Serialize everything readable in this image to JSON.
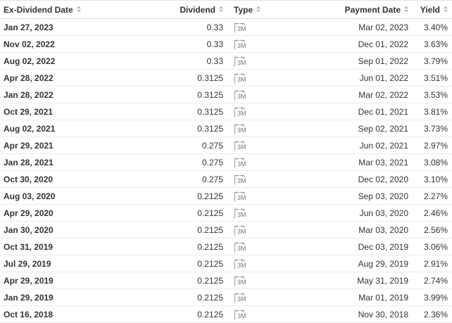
{
  "table": {
    "headers": {
      "ex_dividend_date": "Ex-Dividend Date",
      "dividend": "Dividend",
      "type": "Type",
      "payment_date": "Payment Date",
      "yield": "Yield"
    },
    "type_icon": "calendar-icon",
    "rows": [
      {
        "ex_date": "Jan 27, 2023",
        "dividend": "0.33",
        "type": "3M",
        "pay_date": "Mar 02, 2023",
        "yield": "3.40%"
      },
      {
        "ex_date": "Nov 02, 2022",
        "dividend": "0.33",
        "type": "3M",
        "pay_date": "Dec 01, 2022",
        "yield": "3.63%"
      },
      {
        "ex_date": "Aug 02, 2022",
        "dividend": "0.33",
        "type": "3M",
        "pay_date": "Sep 01, 2022",
        "yield": "3.79%"
      },
      {
        "ex_date": "Apr 28, 2022",
        "dividend": "0.3125",
        "type": "3M",
        "pay_date": "Jun 01, 2022",
        "yield": "3.51%"
      },
      {
        "ex_date": "Jan 28, 2022",
        "dividend": "0.3125",
        "type": "3M",
        "pay_date": "Mar 02, 2022",
        "yield": "3.53%"
      },
      {
        "ex_date": "Oct 29, 2021",
        "dividend": "0.3125",
        "type": "3M",
        "pay_date": "Dec 01, 2021",
        "yield": "3.81%"
      },
      {
        "ex_date": "Aug 02, 2021",
        "dividend": "0.3125",
        "type": "3M",
        "pay_date": "Sep 02, 2021",
        "yield": "3.73%"
      },
      {
        "ex_date": "Apr 29, 2021",
        "dividend": "0.275",
        "type": "3M",
        "pay_date": "Jun 02, 2021",
        "yield": "2.97%"
      },
      {
        "ex_date": "Jan 28, 2021",
        "dividend": "0.275",
        "type": "3M",
        "pay_date": "Mar 03, 2021",
        "yield": "3.08%"
      },
      {
        "ex_date": "Oct 30, 2020",
        "dividend": "0.275",
        "type": "3M",
        "pay_date": "Dec 02, 2020",
        "yield": "3.10%"
      },
      {
        "ex_date": "Aug 03, 2020",
        "dividend": "0.2125",
        "type": "3M",
        "pay_date": "Sep 03, 2020",
        "yield": "2.27%"
      },
      {
        "ex_date": "Apr 29, 2020",
        "dividend": "0.2125",
        "type": "3M",
        "pay_date": "Jun 03, 2020",
        "yield": "2.46%"
      },
      {
        "ex_date": "Jan 30, 2020",
        "dividend": "0.2125",
        "type": "3M",
        "pay_date": "Mar 03, 2020",
        "yield": "2.56%"
      },
      {
        "ex_date": "Oct 31, 2019",
        "dividend": "0.2125",
        "type": "3M",
        "pay_date": "Dec 03, 2019",
        "yield": "3.06%"
      },
      {
        "ex_date": "Jul 29, 2019",
        "dividend": "0.2125",
        "type": "3M",
        "pay_date": "Aug 29, 2019",
        "yield": "2.91%"
      },
      {
        "ex_date": "Apr 29, 2019",
        "dividend": "0.2125",
        "type": "3M",
        "pay_date": "May 31, 2019",
        "yield": "2.74%"
      },
      {
        "ex_date": "Jan 29, 2019",
        "dividend": "0.2125",
        "type": "3M",
        "pay_date": "Mar 01, 2019",
        "yield": "3.99%"
      },
      {
        "ex_date": "Oct 16, 2018",
        "dividend": "0.2125",
        "type": "3M",
        "pay_date": "Nov 30, 2018",
        "yield": "2.36%"
      }
    ]
  }
}
